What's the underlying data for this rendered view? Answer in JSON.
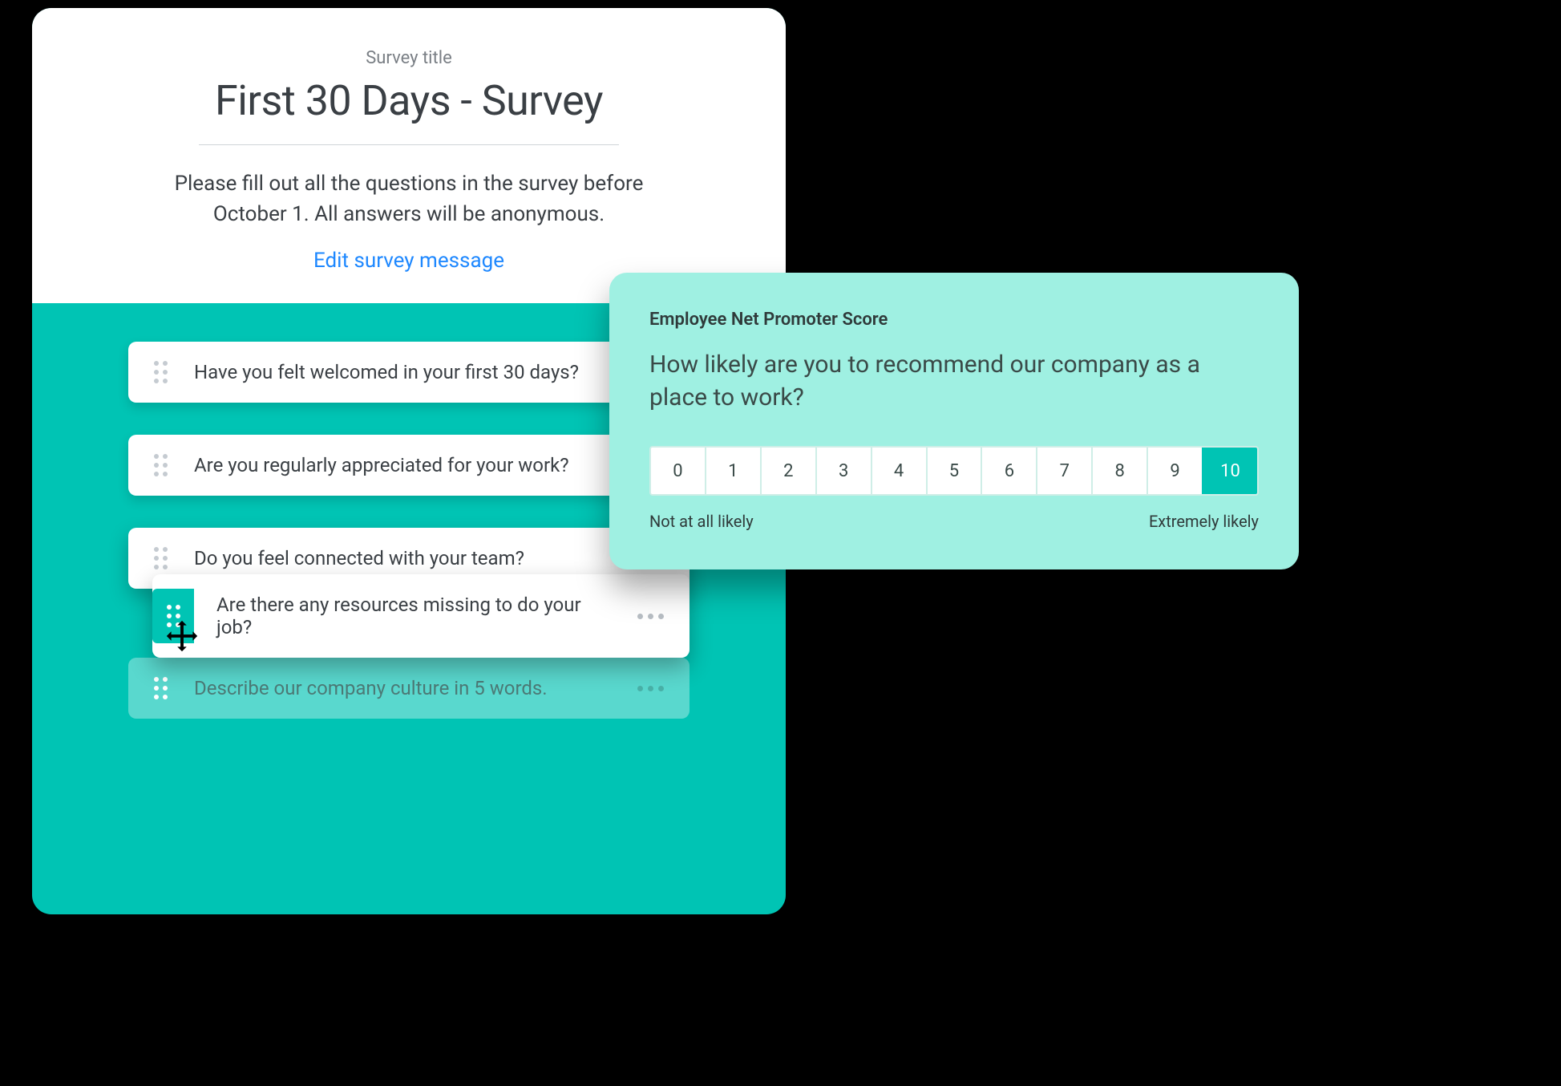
{
  "survey": {
    "title_label": "Survey title",
    "title": "First 30 Days - Survey",
    "message": "Please fill out all the questions in the survey before October 1. All answers will be anonymous.",
    "edit_link": "Edit survey message"
  },
  "questions": [
    {
      "text": "Have you felt welcomed in your first 30 days?",
      "state": "normal"
    },
    {
      "text": "Are you regularly appreciated for your work?",
      "state": "normal"
    },
    {
      "text": "Do you feel connected with your team?",
      "state": "active"
    },
    {
      "text": "Are there any resources missing to do your job?",
      "state": "dragging"
    },
    {
      "text": "Describe our company culture in 5 words.",
      "state": "ghost"
    }
  ],
  "nps": {
    "label": "Employee Net Promoter Score",
    "question": "How likely are you to recommend our company as a place to work?",
    "scale": [
      "0",
      "1",
      "2",
      "3",
      "4",
      "5",
      "6",
      "7",
      "8",
      "9",
      "10"
    ],
    "selected": "10",
    "low_label": "Not at all likely",
    "high_label": "Extremely likely"
  },
  "colors": {
    "teal": "#00c4b4",
    "mint": "#9ff0e2",
    "link": "#1e88ff"
  }
}
